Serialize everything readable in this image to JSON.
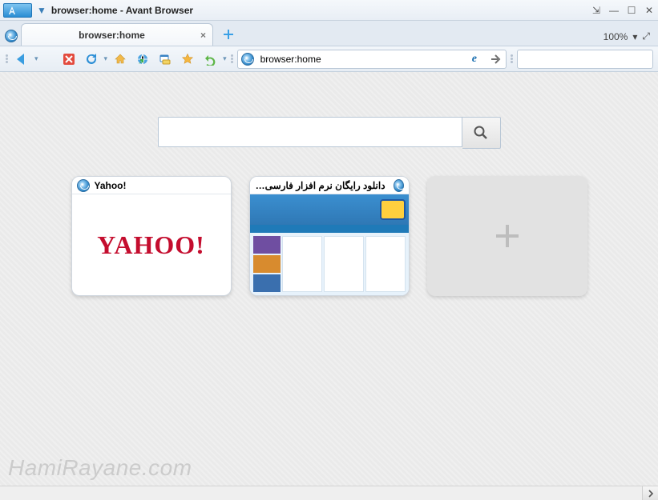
{
  "window": {
    "title": "browser:home - Avant Browser"
  },
  "titlebar_buttons": {
    "popout": "⇲",
    "minimize": "—",
    "maximize": "☐",
    "close": "✕"
  },
  "tabs": {
    "active": {
      "label": "browser:home"
    },
    "newtab_glyph": "+",
    "zoom": "100%",
    "zoom_menu_glyph": "▾",
    "fullscreen_glyph": "⤢"
  },
  "toolbar": {
    "back_glyph": "◀",
    "stop_glyph": "✖",
    "reload_glyph": "↻",
    "home_glyph": "⌂",
    "history_glyph": "🕑",
    "translate_glyph": "🌐",
    "favorites_glyph": "★",
    "undo_glyph": "↶",
    "dropdown_glyph": "▾",
    "address_value": "browser:home",
    "engine_label": "e",
    "go_glyph": "➔",
    "search_icon_color": "#f5a623",
    "search_value": "",
    "search_go_glyph": "🔍",
    "search_menu_glyph": "▾"
  },
  "home": {
    "search_value": "",
    "search_button_glyph": "🔍",
    "tiles": [
      {
        "title": "Yahoo!",
        "logo_text": "YAHOO!"
      },
      {
        "title": "دانلود رایگان نرم افزار فارسی - خرید پ..."
      }
    ],
    "add_tile_glyph": "+"
  },
  "watermark": "HamiRayane.com",
  "scrollbar": {
    "right_glyph": "›"
  }
}
